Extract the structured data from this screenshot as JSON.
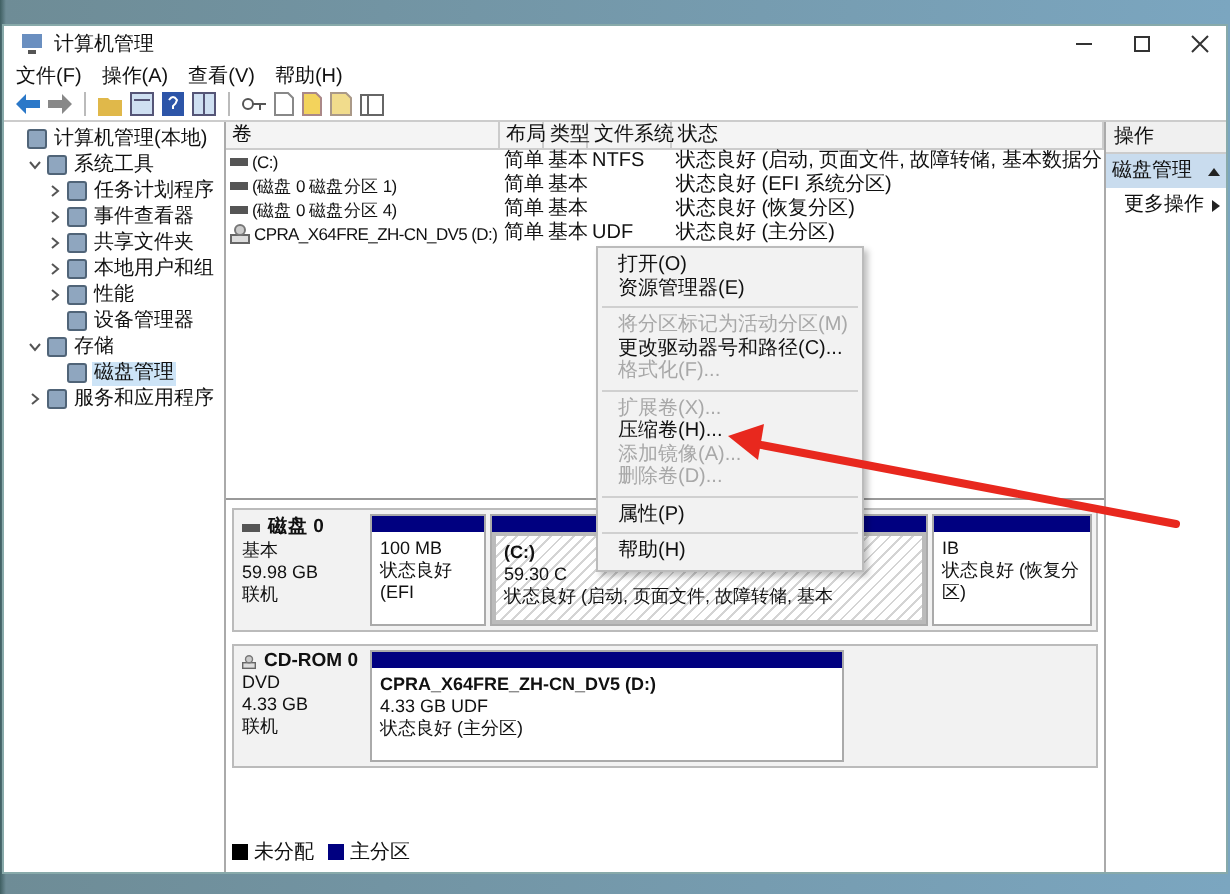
{
  "window": {
    "title": "计算机管理"
  },
  "menu_bar": [
    "文件(F)",
    "操作(A)",
    "查看(V)",
    "帮助(H)"
  ],
  "tree": [
    {
      "label": "计算机管理(本地)",
      "selected": false,
      "children": [
        {
          "label": "系统工具",
          "selected": false,
          "expanded": true,
          "children": [
            {
              "label": "任务计划程序",
              "selected": false,
              "expanded": false
            },
            {
              "label": "事件查看器",
              "selected": false,
              "expanded": false
            },
            {
              "label": "共享文件夹",
              "selected": false,
              "expanded": false
            },
            {
              "label": "本地用户和组",
              "selected": false,
              "expanded": false
            },
            {
              "label": "性能",
              "selected": false,
              "expanded": false
            },
            {
              "label": "设备管理器",
              "selected": false
            }
          ]
        },
        {
          "label": "存储",
          "selected": false,
          "expanded": true,
          "children": [
            {
              "label": "磁盘管理",
              "selected": true
            }
          ]
        },
        {
          "label": "服务和应用程序",
          "selected": false,
          "expanded": false
        }
      ]
    }
  ],
  "volume_table": {
    "columns": [
      "卷",
      "布局",
      "类型",
      "文件系统",
      "状态"
    ],
    "rows": [
      {
        "kind": "disk",
        "cells": [
          "(C:)",
          "简单",
          "基本",
          "NTFS",
          "状态良好 (启动, 页面文件, 故障转储, 基本数据分"
        ]
      },
      {
        "kind": "disk",
        "cells": [
          "(磁盘 0 磁盘分区 1)",
          "简单",
          "基本",
          "",
          "状态良好 (EFI 系统分区)"
        ]
      },
      {
        "kind": "disk",
        "cells": [
          "(磁盘 0 磁盘分区 4)",
          "简单",
          "基本",
          "",
          "状态良好 (恢复分区)"
        ]
      },
      {
        "kind": "cdrom",
        "cells": [
          "CPRA_X64FRE_ZH-CN_DV5 (D:)",
          "简单",
          "基本",
          "UDF",
          "状态良好 (主分区)"
        ]
      }
    ]
  },
  "disks": [
    {
      "kind": "disk",
      "name": "磁盘 0",
      "type": "基本",
      "size": "59.98 GB",
      "status": "联机",
      "partitions": [
        {
          "size": "100 MB",
          "status": "状态良好 (EFI",
          "selected": false
        },
        {
          "title": "(C:)",
          "size": "59.30 C",
          "status": "状态良好 (启动, 页面文件, 故障转储, 基本",
          "selected": true
        },
        {
          "size": "IB",
          "status": "状态良好 (恢复分区)",
          "selected": false
        }
      ]
    },
    {
      "kind": "cdrom",
      "name": "CD-ROM 0",
      "type": "DVD",
      "size": "4.33 GB",
      "status": "联机",
      "partitions": [
        {
          "title": "CPRA_X64FRE_ZH-CN_DV5  (D:)",
          "size": "4.33 GB UDF",
          "status": "状态良好 (主分区)",
          "selected": false
        }
      ]
    }
  ],
  "legend": [
    {
      "label": "未分配",
      "color": "#000000"
    },
    {
      "label": "主分区",
      "color": "#000080"
    }
  ],
  "actions": {
    "header": "操作",
    "section": "磁盘管理",
    "items": [
      "更多操作"
    ]
  },
  "context_menu": [
    {
      "kind": "item",
      "label": "打开(O)",
      "disabled": false
    },
    {
      "kind": "item",
      "label": "资源管理器(E)",
      "disabled": false
    },
    {
      "kind": "separator"
    },
    {
      "kind": "item",
      "label": "将分区标记为活动分区(M)",
      "disabled": true
    },
    {
      "kind": "item",
      "label": "更改驱动器号和路径(C)...",
      "disabled": false
    },
    {
      "kind": "item",
      "label": "格式化(F)...",
      "disabled": true
    },
    {
      "kind": "separator"
    },
    {
      "kind": "item",
      "label": "扩展卷(X)...",
      "disabled": true
    },
    {
      "kind": "item",
      "label": "压缩卷(H)...",
      "disabled": false
    },
    {
      "kind": "item",
      "label": "添加镜像(A)...",
      "disabled": true
    },
    {
      "kind": "item",
      "label": "删除卷(D)...",
      "disabled": true
    },
    {
      "kind": "separator"
    },
    {
      "kind": "item",
      "label": "属性(P)",
      "disabled": false
    },
    {
      "kind": "separator"
    },
    {
      "kind": "item",
      "label": "帮助(H)",
      "disabled": false
    }
  ]
}
